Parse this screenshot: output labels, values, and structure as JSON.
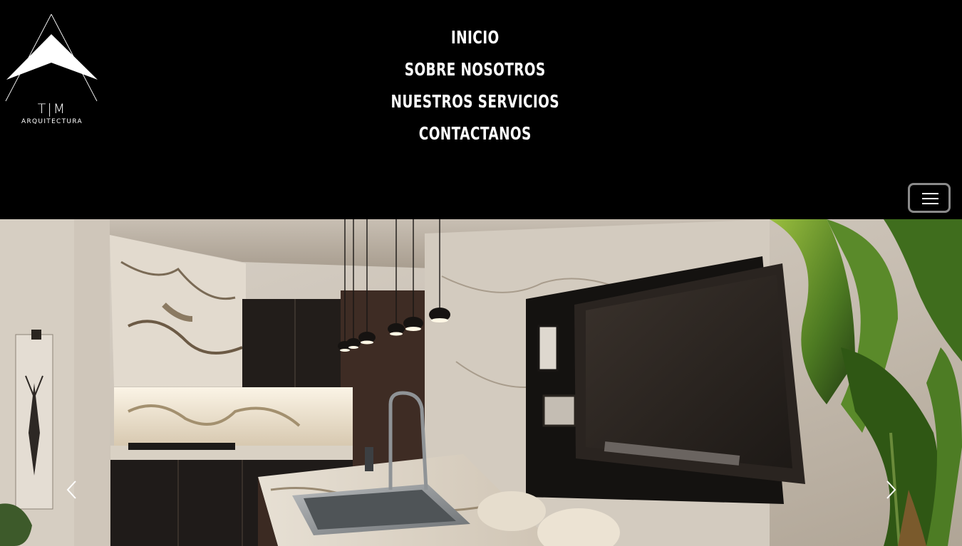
{
  "logo": {
    "letters": "T|M",
    "subtitle": "ARQUITECTURA"
  },
  "nav": {
    "items": [
      {
        "label": "INICIO"
      },
      {
        "label": "SOBRE NOSOTROS"
      },
      {
        "label": "NUESTROS SERVICIOS"
      },
      {
        "label": "CONTACTANOS"
      }
    ]
  },
  "menu_toggle": {
    "icon": "hamburger-menu-icon"
  },
  "hero": {
    "image": "kitchen-interior-photo",
    "prev_icon": "chevron-left-icon",
    "next_icon": "chevron-right-icon"
  },
  "colors": {
    "header_bg": "#000000",
    "nav_text": "#ffffff",
    "toggle_border": "#8a8a8a"
  }
}
